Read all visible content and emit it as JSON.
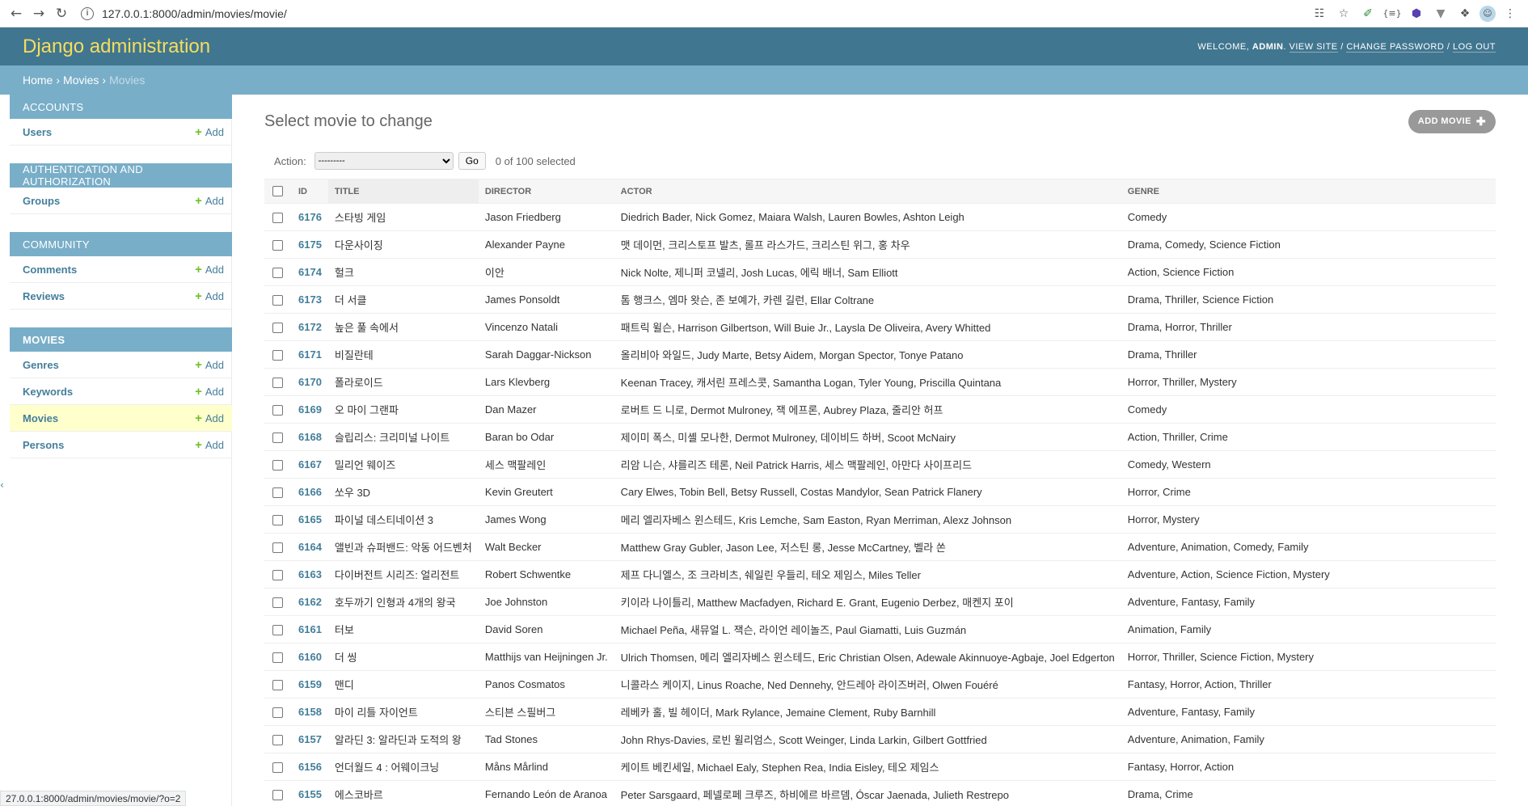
{
  "browser": {
    "url": "127.0.0.1:8000/admin/movies/movie/",
    "status_url": "27.0.0.1:8000/admin/movies/movie/?o=2"
  },
  "header": {
    "branding": "Django administration",
    "welcome": "Welcome, ",
    "username": "admin",
    "view_site": "View site",
    "change_password": "Change password",
    "log_out": "Log out"
  },
  "breadcrumbs": {
    "home": "Home",
    "app": "Movies",
    "current": "Movies"
  },
  "sidebar": {
    "add_label": "Add",
    "modules": [
      {
        "caption": "Accounts",
        "models": [
          "Users"
        ]
      },
      {
        "caption": "Authentication and Authorization",
        "models": [
          "Groups"
        ]
      },
      {
        "caption": "Community",
        "models": [
          "Comments",
          "Reviews"
        ]
      },
      {
        "caption": "Movies",
        "models": [
          "Genres",
          "Keywords",
          "Movies",
          "Persons"
        ]
      }
    ]
  },
  "content": {
    "title": "Select movie to change",
    "add_button": "ADD MOVIE",
    "action_label": "Action:",
    "action_placeholder": "---------",
    "go_label": "Go",
    "selected_text": "0 of 100 selected",
    "columns": [
      "ID",
      "Title",
      "Director",
      "Actor",
      "Genre"
    ]
  },
  "rows": [
    [
      "6176",
      "스타빙 게임",
      "Jason Friedberg",
      "Diedrich Bader, Nick Gomez, Maiara Walsh, Lauren Bowles, Ashton Leigh",
      "Comedy"
    ],
    [
      "6175",
      "다운사이징",
      "Alexander Payne",
      "맷 데이먼, 크리스토프 발츠, 롤프 라스가드, 크리스틴 위그, 홍 차우",
      "Drama, Comedy, Science Fiction"
    ],
    [
      "6174",
      "헐크",
      "이안",
      "Nick Nolte, 제니퍼 코넬리, Josh Lucas, 에릭 배너, Sam Elliott",
      "Action, Science Fiction"
    ],
    [
      "6173",
      "더 서클",
      "James Ponsoldt",
      "톰 행크스, 엠마 왓슨, 존 보예가, 카렌 길런, Ellar Coltrane",
      "Drama, Thriller, Science Fiction"
    ],
    [
      "6172",
      "높은 풀 속에서",
      "Vincenzo Natali",
      "패트릭 윌슨, Harrison Gilbertson, Will Buie Jr., Laysla De Oliveira, Avery Whitted",
      "Drama, Horror, Thriller"
    ],
    [
      "6171",
      "비질란테",
      "Sarah Daggar-Nickson",
      "올리비아 와일드, Judy Marte, Betsy Aidem, Morgan Spector, Tonye Patano",
      "Drama, Thriller"
    ],
    [
      "6170",
      "폴라로이드",
      "Lars Klevberg",
      "Keenan Tracey, 캐서린 프레스콧, Samantha Logan, Tyler Young, Priscilla Quintana",
      "Horror, Thriller, Mystery"
    ],
    [
      "6169",
      "오 마이 그랜파",
      "Dan Mazer",
      "로버트 드 니로, Dermot Mulroney, 잭 에프론, Aubrey Plaza, 줄리안 허프",
      "Comedy"
    ],
    [
      "6168",
      "슬립리스: 크리미널 나이트",
      "Baran bo Odar",
      "제이미 폭스, 미셸 모나한, Dermot Mulroney, 데이비드 하버, Scoot McNairy",
      "Action, Thriller, Crime"
    ],
    [
      "6167",
      "밀리언 웨이즈",
      "세스 맥팔레인",
      "리암 니슨, 샤를리즈 테론, Neil Patrick Harris, 세스 맥팔레인, 아만다 사이프리드",
      "Comedy, Western"
    ],
    [
      "6166",
      "쏘우 3D",
      "Kevin Greutert",
      "Cary Elwes, Tobin Bell, Betsy Russell, Costas Mandylor, Sean Patrick Flanery",
      "Horror, Crime"
    ],
    [
      "6165",
      "파이널 데스티네이션 3",
      "James Wong",
      "메리 엘리자베스 윈스테드, Kris Lemche, Sam Easton, Ryan Merriman, Alexz Johnson",
      "Horror, Mystery"
    ],
    [
      "6164",
      "앨빈과 슈퍼밴드: 악동 어드벤처",
      "Walt Becker",
      "Matthew Gray Gubler, Jason Lee, 저스틴 롱, Jesse McCartney, 벨라 쏜",
      "Adventure, Animation, Comedy, Family"
    ],
    [
      "6163",
      "다이버전트 시리즈: 얼리전트",
      "Robert Schwentke",
      "제프 다니엘스, 조 크라비츠, 쉐일린 우들리, 테오 제임스, Miles Teller",
      "Adventure, Action, Science Fiction, Mystery"
    ],
    [
      "6162",
      "호두까기 인형과 4개의 왕국",
      "Joe Johnston",
      "키이라 나이틀리, Matthew Macfadyen, Richard E. Grant, Eugenio Derbez, 매켄지 포이",
      "Adventure, Fantasy, Family"
    ],
    [
      "6161",
      "터보",
      "David Soren",
      "Michael Peña, 새뮤얼 L. 잭슨, 라이언 레이놀즈, Paul Giamatti, Luis Guzmán",
      "Animation, Family"
    ],
    [
      "6160",
      "더 씽",
      "Matthijs van Heijningen Jr.",
      "Ulrich Thomsen, 메리 엘리자베스 윈스테드, Eric Christian Olsen, Adewale Akinnuoye-Agbaje, Joel Edgerton",
      "Horror, Thriller, Science Fiction, Mystery"
    ],
    [
      "6159",
      "맨디",
      "Panos Cosmatos",
      "니콜라스 케이지, Linus Roache, Ned Dennehy, 안드레아 라이즈버러, Olwen Fouéré",
      "Fantasy, Horror, Action, Thriller"
    ],
    [
      "6158",
      "마이 리틀 자이언트",
      "스티븐 스필버그",
      "레베카 홀, 빌 헤이더, Mark Rylance, Jemaine Clement, Ruby Barnhill",
      "Adventure, Fantasy, Family"
    ],
    [
      "6157",
      "알라딘 3: 알라딘과 도적의 왕",
      "Tad Stones",
      "John Rhys-Davies, 로빈 윌리엄스, Scott Weinger, Linda Larkin, Gilbert Gottfried",
      "Adventure, Animation, Family"
    ],
    [
      "6156",
      "언더월드 4 : 어웨이크닝",
      "Måns Mårlind",
      "케이트 베킨세일, Michael Ealy, Stephen Rea, India Eisley, 테오 제임스",
      "Fantasy, Horror, Action"
    ],
    [
      "6155",
      "에스코바르",
      "Fernando León de Aranoa",
      "Peter Sarsgaard, 페넬로페 크루즈, 하비에르 바르뎀, Óscar Jaenada, Julieth Restrepo",
      "Drama, Crime"
    ]
  ]
}
